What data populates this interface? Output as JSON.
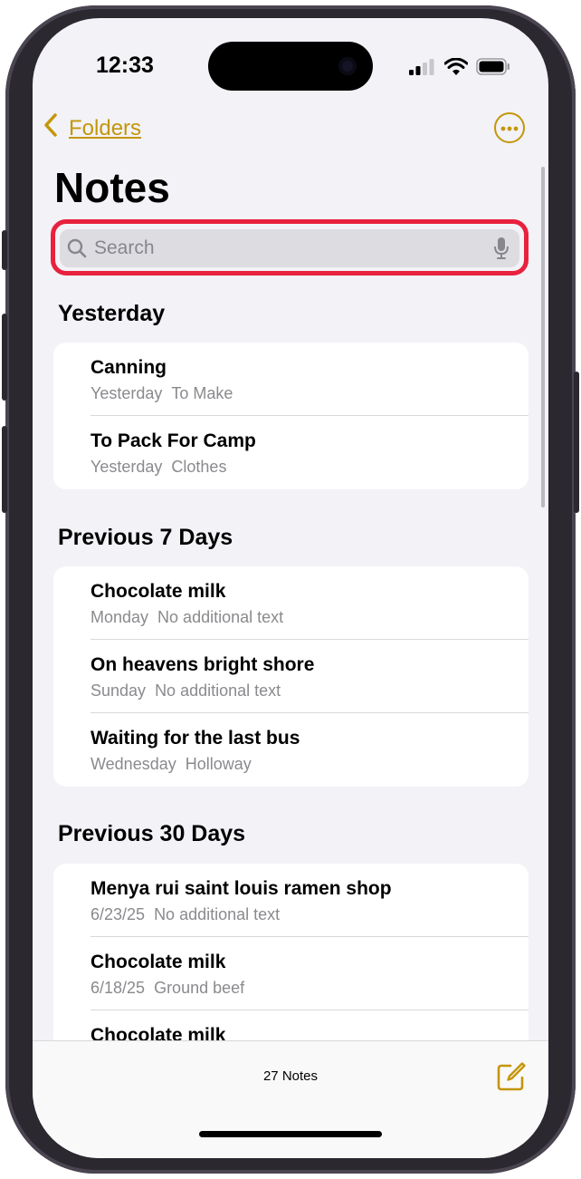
{
  "status": {
    "time": "12:33"
  },
  "nav": {
    "back_label": "Folders"
  },
  "title": "Notes",
  "search": {
    "placeholder": "Search"
  },
  "sections": [
    {
      "header": "Yesterday",
      "items": [
        {
          "title": "Canning",
          "date": "Yesterday",
          "detail": "To Make"
        },
        {
          "title": "To Pack For Camp",
          "date": "Yesterday",
          "detail": "Clothes"
        }
      ]
    },
    {
      "header": "Previous 7 Days",
      "items": [
        {
          "title": "Chocolate milk",
          "date": "Monday",
          "detail": "No additional text"
        },
        {
          "title": "On heavens bright shore",
          "date": "Sunday",
          "detail": "No additional text"
        },
        {
          "title": "Waiting for the last bus",
          "date": "Wednesday",
          "detail": "Holloway"
        }
      ]
    },
    {
      "header": "Previous 30 Days",
      "items": [
        {
          "title": "Menya rui saint louis ramen shop",
          "date": "6/23/25",
          "detail": "No additional text"
        },
        {
          "title": "Chocolate milk",
          "date": "6/18/25",
          "detail": "Ground beef"
        },
        {
          "title": "Chocolate milk",
          "date": "",
          "detail": ""
        }
      ]
    }
  ],
  "bottom_bar": {
    "count": "27 Notes"
  },
  "colors": {
    "accent": "#c4960a",
    "highlight": "#e8213e",
    "background": "#f2f2f7"
  },
  "icons": [
    "chevron-left-icon",
    "more-icon",
    "search-icon",
    "microphone-icon",
    "compose-icon",
    "signal-icon",
    "wifi-icon",
    "battery-icon"
  ]
}
